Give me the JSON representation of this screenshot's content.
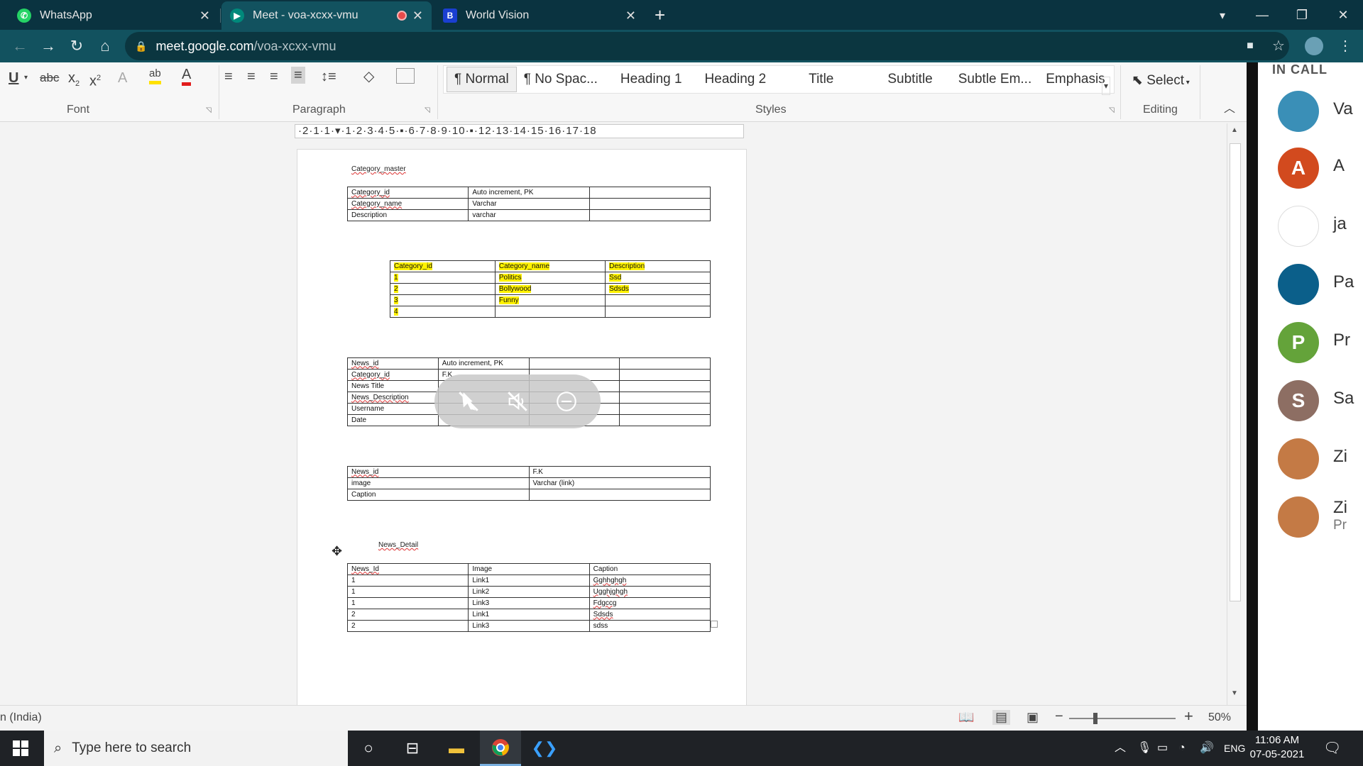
{
  "browser": {
    "tabs": [
      {
        "title": "WhatsApp",
        "icon": "whatsapp-icon",
        "color": "#25d366"
      },
      {
        "title": "Meet - voa-xcxx-vmu",
        "icon": "meet-icon",
        "color": "#00897b"
      },
      {
        "title": "World Vision",
        "icon": "worldvision-icon",
        "color": "#1a3fd1"
      }
    ],
    "url_domain": "meet.google.com",
    "url_path": "/voa-xcxx-vmu"
  },
  "word": {
    "groups": {
      "font": "Font",
      "paragraph": "Paragraph",
      "styles": "Styles",
      "editing": "Editing"
    },
    "styles": [
      "¶ Normal",
      "¶ No Spac...",
      "Heading 1",
      "Heading 2",
      "Title",
      "Subtitle",
      "Subtle Em...",
      "Emphasis"
    ],
    "select_label": "Select",
    "ruler": "·2·1·1·▾·1·2·3·4·5·▪·6·7·8·9·10·▪·12·13·14·15·16·17·18",
    "status_lang": "n (India)",
    "zoom": "50%"
  },
  "document": {
    "title1": "Category_master",
    "table1": [
      [
        "Category_id",
        "Auto increment, PK",
        ""
      ],
      [
        "Category_name",
        "Varchar",
        ""
      ],
      [
        "Description",
        "varchar",
        ""
      ]
    ],
    "table2": [
      [
        "Category_id",
        "Category_name",
        "Description"
      ],
      [
        "1",
        "Politics",
        "Ssd"
      ],
      [
        "2",
        "Bollywood",
        "Sdsds"
      ],
      [
        "3",
        "Funny",
        ""
      ],
      [
        "4",
        "",
        ""
      ]
    ],
    "table3": [
      [
        "News_id",
        "Auto increment, PK",
        "",
        ""
      ],
      [
        "Category_id",
        "F.K",
        "",
        ""
      ],
      [
        "News Title",
        "",
        "",
        ""
      ],
      [
        "News_Description",
        "",
        "",
        ""
      ],
      [
        "Username",
        "",
        "",
        ""
      ],
      [
        "Date",
        "",
        "",
        ""
      ]
    ],
    "table4": [
      [
        "News_id",
        "F.K"
      ],
      [
        "image",
        "Varchar (link)"
      ],
      [
        "Caption",
        ""
      ]
    ],
    "title5": "News_Detail",
    "table5": [
      [
        "News_Id",
        "Image",
        "Caption"
      ],
      [
        "1",
        "Link1",
        "Gghhghgh"
      ],
      [
        "1",
        "Link2",
        "Ugghjghgh"
      ],
      [
        "1",
        "Link3",
        "Fdgccg"
      ],
      [
        "2",
        "Link1",
        "Sdsds"
      ],
      [
        "2",
        "Link3",
        "sdss"
      ]
    ]
  },
  "meet": {
    "header": "IN CALL",
    "participants": [
      {
        "name": "Va",
        "avatar": "",
        "color": "#3a8fb7"
      },
      {
        "name": "A",
        "avatar": "A",
        "color": "#d24a1e"
      },
      {
        "name": "ja",
        "avatar": "",
        "color": "#ffffff"
      },
      {
        "name": "Pa",
        "avatar": "",
        "color": "#0b5f8a"
      },
      {
        "name": "Pr",
        "avatar": "P",
        "color": "#64a33a"
      },
      {
        "name": "Sa",
        "avatar": "S",
        "color": "#8d6e63"
      },
      {
        "name": "Zi",
        "avatar": "",
        "color": "#c47a45"
      },
      {
        "name": "Zi",
        "avatar": "",
        "color": "#c47a45",
        "sub": "Pr"
      }
    ]
  },
  "taskbar": {
    "search_placeholder": "Type here to search",
    "lang": "ENG",
    "time": "11:06 AM",
    "date": "07-05-2021"
  }
}
